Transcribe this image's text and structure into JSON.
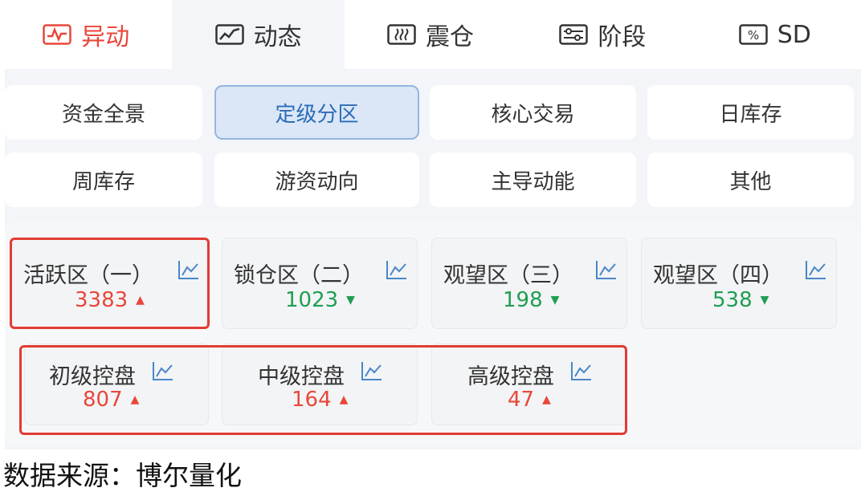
{
  "tabs": [
    {
      "label": "异动",
      "icon": "pulse-icon"
    },
    {
      "label": "动态",
      "icon": "line-chart-icon"
    },
    {
      "label": "震仓",
      "icon": "wave-icon"
    },
    {
      "label": "阶段",
      "icon": "slider-icon"
    },
    {
      "label": "SD",
      "icon": "percent-icon"
    }
  ],
  "categories": [
    {
      "label": "资金全景"
    },
    {
      "label": "定级分区",
      "selected": true
    },
    {
      "label": "核心交易"
    },
    {
      "label": "日库存"
    },
    {
      "label": "周库存"
    },
    {
      "label": "游资动向"
    },
    {
      "label": "主导动能"
    },
    {
      "label": "其他"
    }
  ],
  "zones": [
    {
      "name": "活跃区（一）",
      "value": "3383",
      "trend": "up"
    },
    {
      "name": "锁仓区（二）",
      "value": "1023",
      "trend": "down"
    },
    {
      "name": "观望区（三）",
      "value": "198",
      "trend": "down"
    },
    {
      "name": "观望区（四）",
      "value": "538",
      "trend": "down"
    }
  ],
  "control": [
    {
      "name": "初级控盘",
      "value": "807",
      "trend": "up"
    },
    {
      "name": "中级控盘",
      "value": "164",
      "trend": "up"
    },
    {
      "name": "高级控盘",
      "value": "47",
      "trend": "up"
    }
  ],
  "source_text": "数据来源：博尔量化",
  "colors": {
    "accent_red": "#e8473a",
    "down_green": "#1f9e52",
    "selected_blue": "#2b6cb8"
  },
  "arrows": {
    "up": "▲",
    "down": "▼"
  }
}
